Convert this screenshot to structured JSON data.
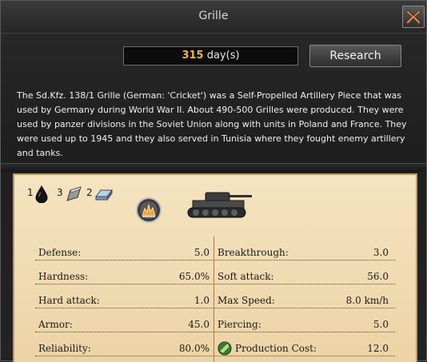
{
  "window": {
    "title": "Grille"
  },
  "header": {
    "days_value": "315",
    "days_unit": "day(s)",
    "research_label": "Research"
  },
  "description": "The Sd.Kfz. 138/1 Grille (German: 'Cricket') was a Self-Propelled Artillery Piece that was used by Germany during World War II. About 490-500 Grilles were produced. They were used by panzer divisions in the Soviet Union along with units in Poland and France. They were used up to 1945 and they also served in Tunisia where they fought enemy artillery and tanks.",
  "resources": [
    {
      "icon": "oil-drop-icon",
      "value": "1"
    },
    {
      "icon": "steel-icon",
      "value": "3"
    },
    {
      "icon": "aluminium-icon",
      "value": "2"
    }
  ],
  "icons": {
    "ability": "explosion-icon",
    "unit": "tank-icon",
    "production": "production-gear-icon"
  },
  "stats_left": [
    {
      "label": "Defense:",
      "value": "5.0"
    },
    {
      "label": "Hardness:",
      "value": "65.0%"
    },
    {
      "label": "Hard attack:",
      "value": "1.0"
    },
    {
      "label": "Armor:",
      "value": "45.0"
    },
    {
      "label": "Reliability:",
      "value": "80.0%"
    }
  ],
  "stats_right": [
    {
      "label": "Breakthrough:",
      "value": "3.0"
    },
    {
      "label": "Soft attack:",
      "value": "56.0"
    },
    {
      "label": "Max Speed:",
      "value": "8.0 km/h"
    },
    {
      "label": "Piercing:",
      "value": "5.0"
    },
    {
      "label": "Production Cost:",
      "value": "12.0"
    }
  ],
  "colors": {
    "accent": "#f0b63c",
    "paper": "#f5e4c0",
    "divider": "#c0714a"
  }
}
